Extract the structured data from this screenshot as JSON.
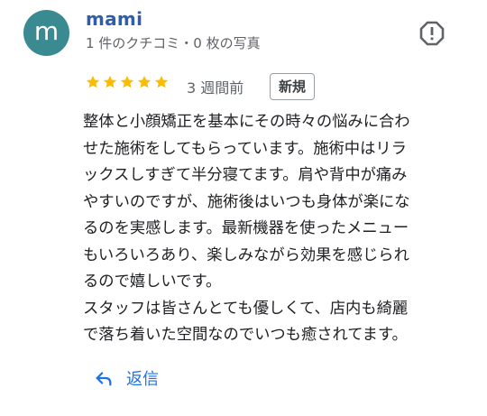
{
  "review": {
    "avatar_initial": "m",
    "author": "mami",
    "meta": "1 件のクチコミ・0 枚の写真",
    "rating": 5,
    "rating_max": 5,
    "age": "3 週間前",
    "badge": "新規",
    "text": "整体と小顔矯正を基本にその時々の悩みに合わ\nせた施術をしてもらっています。施術中はリラ\nックスしすぎて半分寝てます。肩や背中が痛み\nやすいのですが、施術後はいつも身体が楽にな\nるのを実感します。最新機器を使ったメニュー\nもいろいろあり、楽しみながら効果を感じられ\nるので嬉しいです。\nスタッフは皆さんとても優しくて、店内も綺麗\nで落ち着いた空間なのでいつも癒されてます。",
    "reply_label": "返信"
  },
  "icons": {
    "report": "report-flag-icon",
    "star": "star-icon",
    "reply": "reply-arrow-icon"
  },
  "colors": {
    "avatar_bg": "#3a8a92",
    "author": "#2f5eab",
    "star": "#fbbc04",
    "reply": "#1a73e8"
  }
}
